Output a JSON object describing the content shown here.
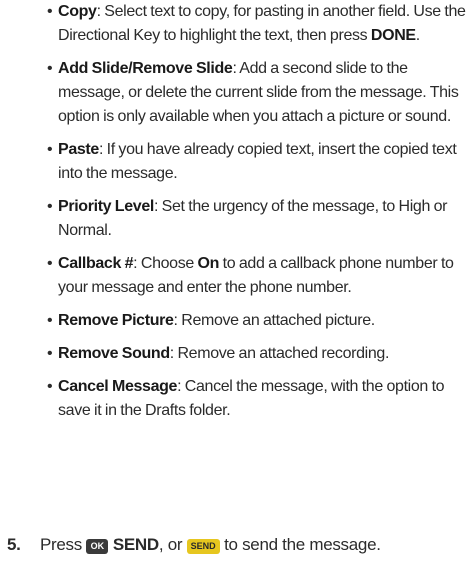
{
  "options": [
    {
      "bullet": "•",
      "parts": [
        {
          "b": "Copy"
        },
        {
          "t": ": Select text to copy, for pasting in another field. Use the Directional Key to highlight the text, then press "
        },
        {
          "b": "DONE"
        },
        {
          "t": "."
        }
      ]
    },
    {
      "bullet": "•",
      "parts": [
        {
          "b": "Add Slide/Remove Slide"
        },
        {
          "t": ": Add a second slide to the message, or delete the current slide from the message. This option is only available when you attach a picture or sound."
        }
      ]
    },
    {
      "bullet": "•",
      "parts": [
        {
          "b": "Paste"
        },
        {
          "t": ": If you have already copied text, insert the copied text into the message."
        }
      ]
    },
    {
      "bullet": "•",
      "parts": [
        {
          "b": "Priority Level"
        },
        {
          "t": ": Set the urgency of the message, to High or Normal."
        }
      ]
    },
    {
      "bullet": "•",
      "parts": [
        {
          "b": "Callback #"
        },
        {
          "t": ": Choose "
        },
        {
          "b": "On"
        },
        {
          "t": " to add a callback phone number to your message and enter the phone number."
        }
      ]
    },
    {
      "bullet": "•",
      "parts": [
        {
          "b": "Remove Picture"
        },
        {
          "t": ": Remove an attached picture."
        }
      ]
    },
    {
      "bullet": "•",
      "parts": [
        {
          "b": "Remove Sound"
        },
        {
          "t": ": Remove an attached recording."
        }
      ]
    },
    {
      "bullet": "•",
      "parts": [
        {
          "b": "Cancel Message"
        },
        {
          "t": ": Cancel the message, with the option to save it in the Drafts folder."
        }
      ]
    }
  ],
  "step5": {
    "number": "5.",
    "press_text": "Press ",
    "ok_key_label": "OK",
    "ok_key_icon": "ok-key-icon",
    "send_bold": " SEND",
    "or_text": ", or ",
    "send_key_label": "SEND",
    "send_key_icon": "send-key-icon",
    "end_text": " to send the message."
  },
  "colors": {
    "text": "#2b2b2b",
    "ok_key_bg": "#3a3a3a",
    "send_key_bg": "#e6c61f"
  }
}
